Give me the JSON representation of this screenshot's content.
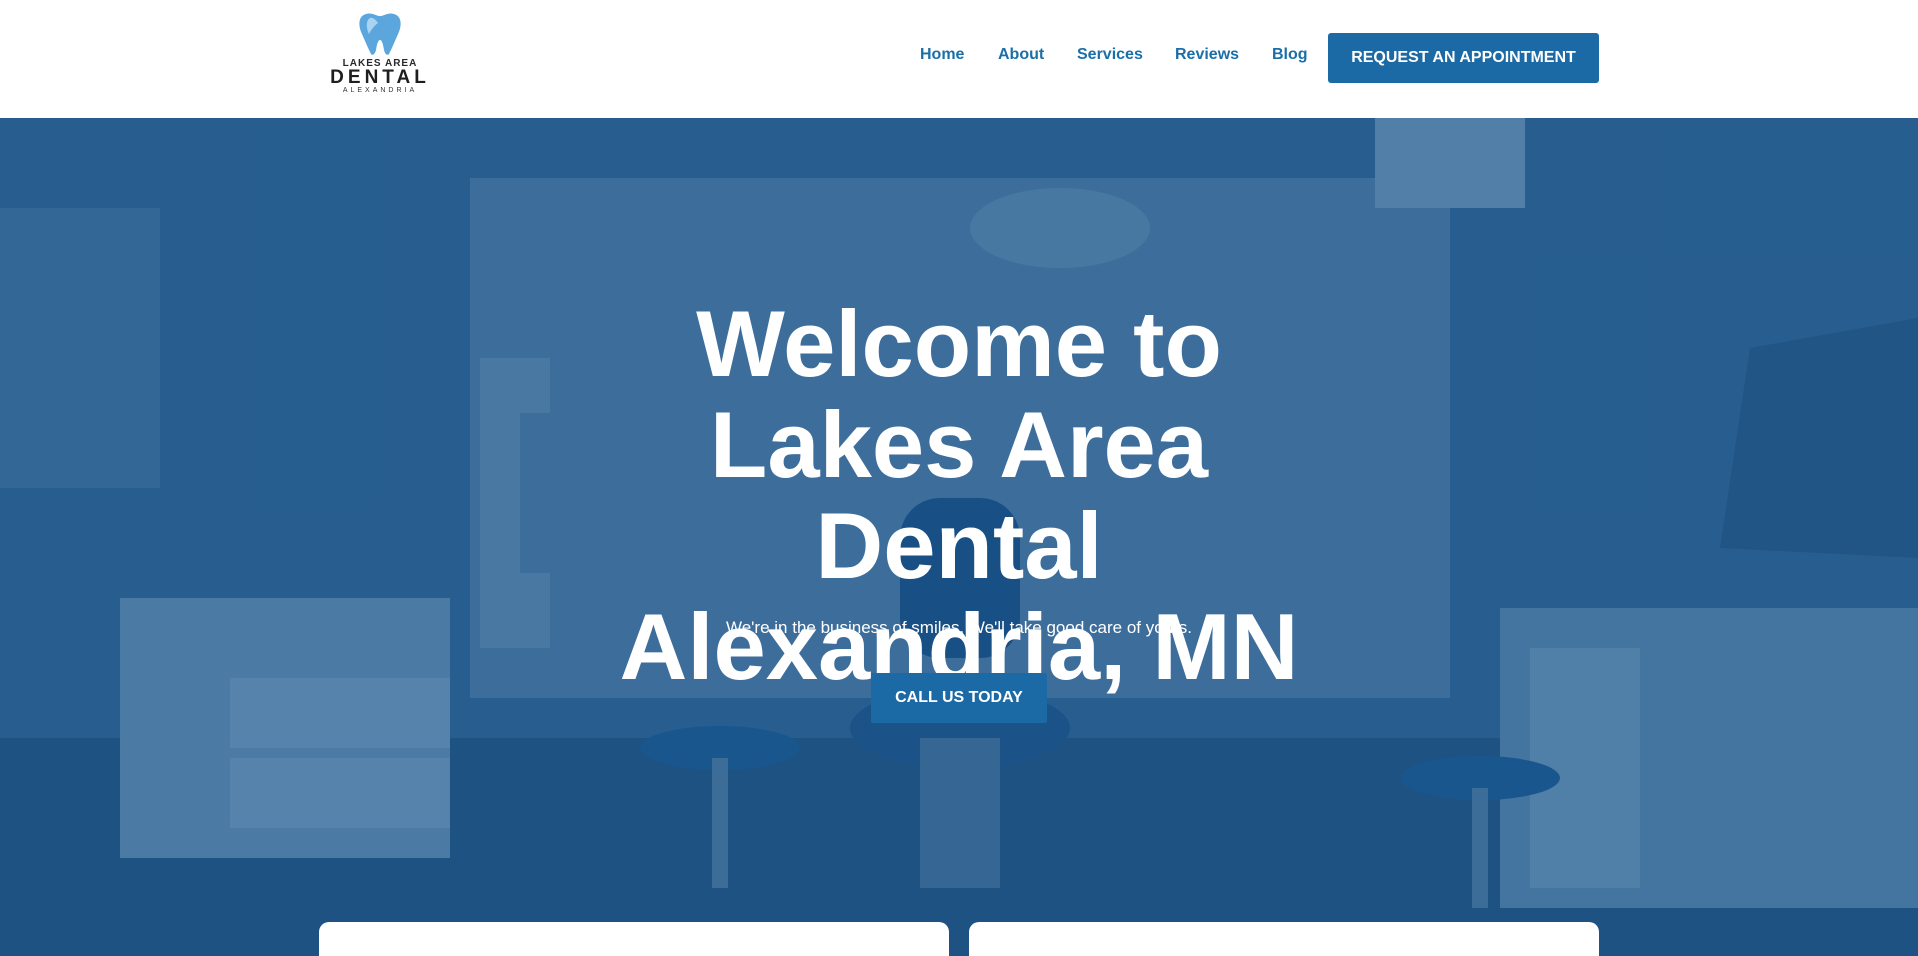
{
  "brand": {
    "logo_line1": "LAKES AREA",
    "logo_line2": "DENTAL",
    "logo_line3": "ALEXANDRIA",
    "accent_color": "#1b6aa5",
    "nav_color": "#1a6fa8"
  },
  "nav": {
    "items": [
      {
        "label": "Home"
      },
      {
        "label": "About"
      },
      {
        "label": "Services"
      },
      {
        "label": "Reviews"
      },
      {
        "label": "Blog"
      }
    ],
    "cta_label": "REQUEST AN APPOINTMENT"
  },
  "hero": {
    "title": "Welcome to Lakes Area Dental Alexandria, MN",
    "subtitle": "We're in the business of smiles. We'll take good care of yours.",
    "cta_label": "CALL US TODAY",
    "background": "dental-office-photo"
  }
}
